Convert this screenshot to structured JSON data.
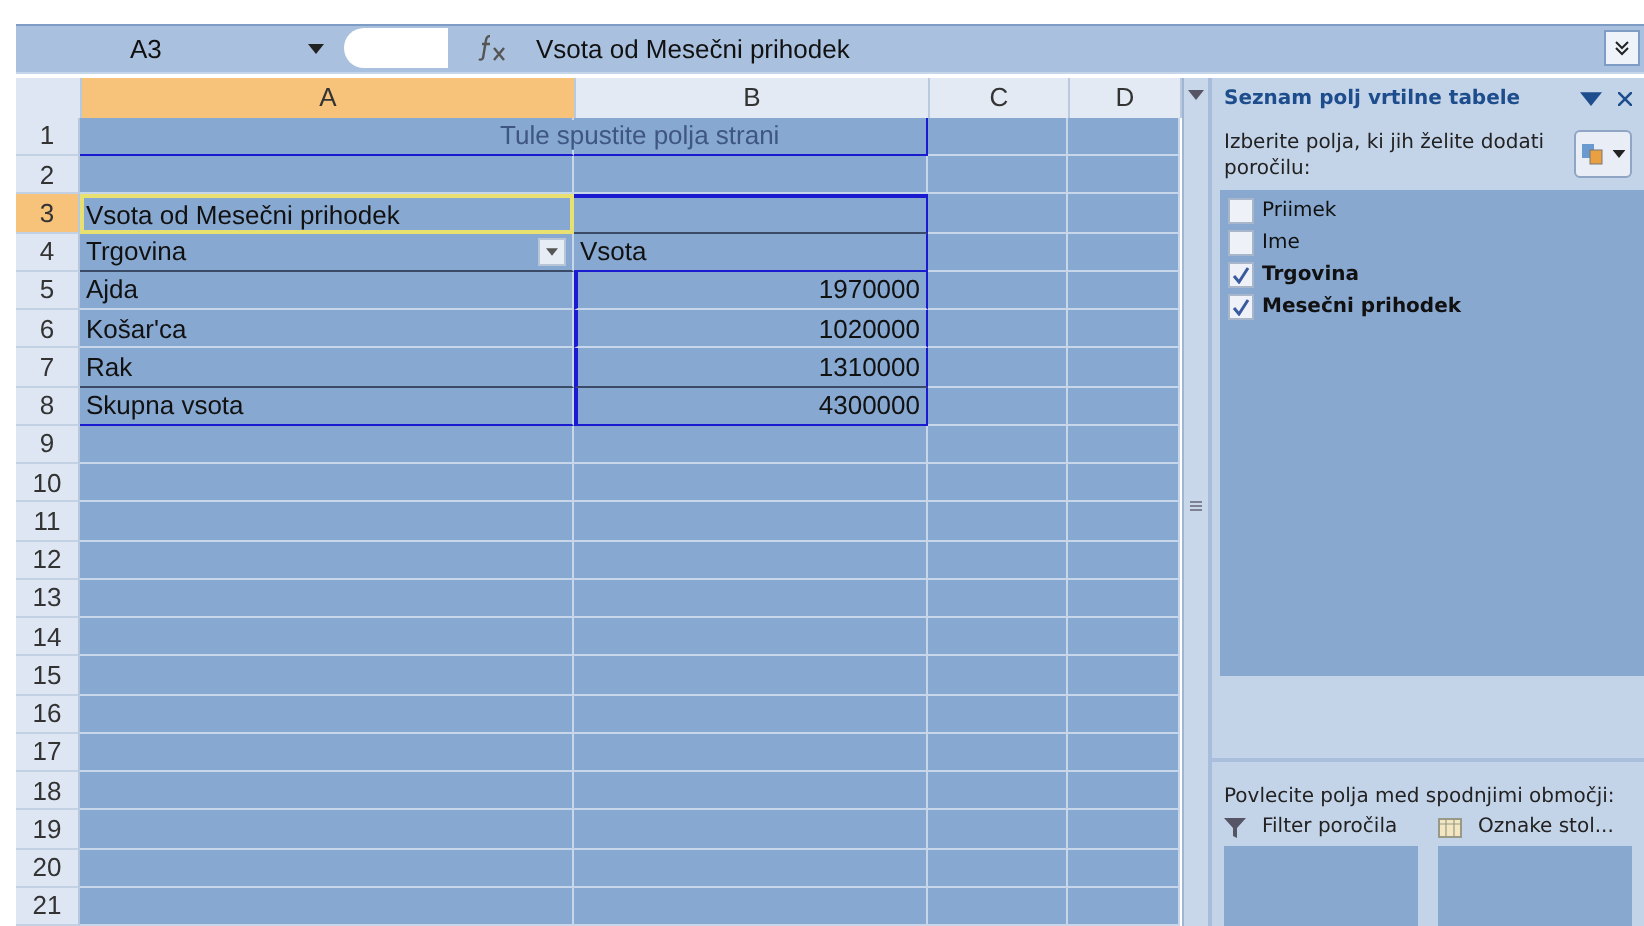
{
  "formula_bar": {
    "name_box": "A3",
    "formula": "Vsota od Mesečni prihodek"
  },
  "sheet": {
    "columns": [
      {
        "label": "A",
        "selected": true
      },
      {
        "label": "B",
        "selected": false
      },
      {
        "label": "C",
        "selected": false
      },
      {
        "label": "D",
        "selected": false
      }
    ],
    "rows": [
      {
        "number": "1",
        "selected": false,
        "kind": "hint",
        "a": "Tule spustite polja strani"
      },
      {
        "number": "2",
        "selected": false,
        "kind": "empty"
      },
      {
        "number": "3",
        "selected": true,
        "kind": "title",
        "a": "Vsota od Mesečni prihodek"
      },
      {
        "number": "4",
        "selected": false,
        "kind": "header",
        "a": "Trgovina",
        "b": "Vsota"
      },
      {
        "number": "5",
        "selected": false,
        "kind": "item",
        "a": "Ajda",
        "b": "1970000"
      },
      {
        "number": "6",
        "selected": false,
        "kind": "item",
        "a": "Košar'ca",
        "b": "1020000"
      },
      {
        "number": "7",
        "selected": false,
        "kind": "item",
        "a": "Rak",
        "b": "1310000"
      },
      {
        "number": "8",
        "selected": false,
        "kind": "total",
        "a": "Skupna vsota",
        "b": "4300000"
      },
      {
        "number": "9",
        "selected": false,
        "kind": "empty"
      },
      {
        "number": "10",
        "selected": false,
        "kind": "empty"
      },
      {
        "number": "11",
        "selected": false,
        "kind": "empty"
      },
      {
        "number": "12",
        "selected": false,
        "kind": "empty"
      },
      {
        "number": "13",
        "selected": false,
        "kind": "empty"
      },
      {
        "number": "14",
        "selected": false,
        "kind": "empty"
      },
      {
        "number": "15",
        "selected": false,
        "kind": "empty"
      },
      {
        "number": "16",
        "selected": false,
        "kind": "empty"
      },
      {
        "number": "17",
        "selected": false,
        "kind": "empty"
      },
      {
        "number": "18",
        "selected": false,
        "kind": "empty"
      },
      {
        "number": "19",
        "selected": false,
        "kind": "empty"
      },
      {
        "number": "20",
        "selected": false,
        "kind": "empty"
      },
      {
        "number": "21",
        "selected": false,
        "kind": "empty"
      }
    ]
  },
  "field_list": {
    "title": "Seznam polj vrtilne tabele",
    "instruction": "Izberite polja, ki jih želite dodati poročilu:",
    "fields": [
      {
        "label": "Priimek",
        "checked": false
      },
      {
        "label": "Ime",
        "checked": false
      },
      {
        "label": "Trgovina",
        "checked": true
      },
      {
        "label": "Mesečni prihodek",
        "checked": true
      }
    ],
    "drag_instruction": "Povlecite polja med spodnjimi območji:",
    "areas": [
      {
        "label": "Filter poročila",
        "kind": "filter"
      },
      {
        "label": "Oznake stol...",
        "kind": "columns"
      }
    ]
  }
}
